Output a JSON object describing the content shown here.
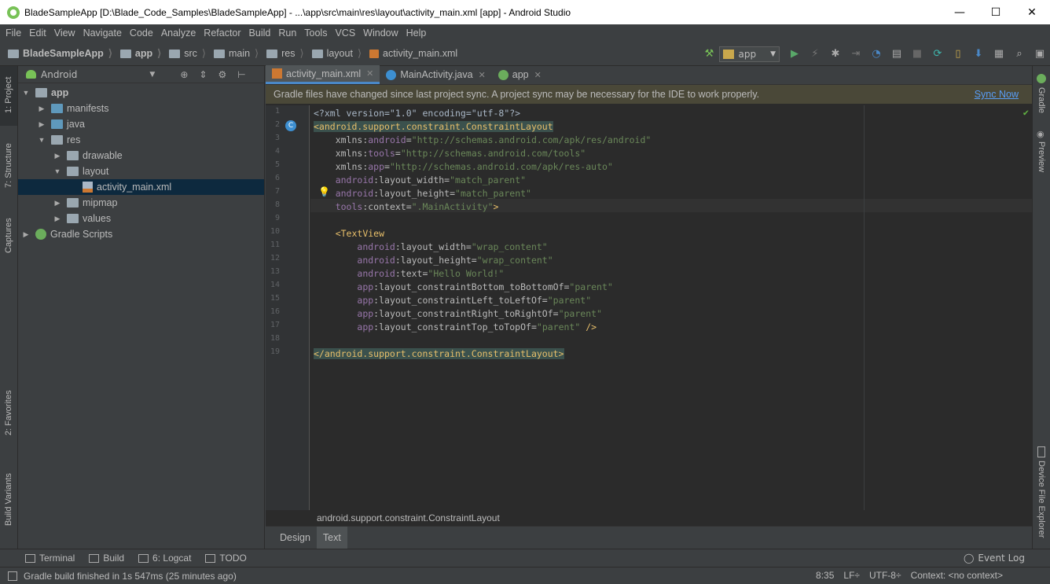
{
  "window": {
    "title": "BladeSampleApp [D:\\Blade_Code_Samples\\BladeSampleApp] - ...\\app\\src\\main\\res\\layout\\activity_main.xml [app] - Android Studio",
    "minimize": "—",
    "maximize": "☐",
    "close": "✕"
  },
  "menu": [
    "File",
    "Edit",
    "View",
    "Navigate",
    "Code",
    "Analyze",
    "Refactor",
    "Build",
    "Run",
    "Tools",
    "VCS",
    "Window",
    "Help"
  ],
  "breadcrumb": [
    "BladeSampleApp",
    "app",
    "src",
    "main",
    "res",
    "layout",
    "activity_main.xml"
  ],
  "toolbar": {
    "run_config": "app"
  },
  "left_strip": [
    "1: Project",
    "7: Structure",
    "Captures",
    "2: Favorites",
    "Build Variants"
  ],
  "right_strip": [
    "Gradle",
    "Preview",
    "Device File Explorer"
  ],
  "project_panel": {
    "view_mode": "Android",
    "tree": [
      {
        "label": "app",
        "depth": 0,
        "expanded": true,
        "icon": "module-folder-icon"
      },
      {
        "label": "manifests",
        "depth": 1,
        "expanded": false,
        "icon": "folder-icon"
      },
      {
        "label": "java",
        "depth": 1,
        "expanded": false,
        "icon": "folder-icon"
      },
      {
        "label": "res",
        "depth": 1,
        "expanded": true,
        "icon": "folder-icon"
      },
      {
        "label": "drawable",
        "depth": 2,
        "expanded": false,
        "icon": "folder-icon"
      },
      {
        "label": "layout",
        "depth": 2,
        "expanded": true,
        "icon": "folder-icon"
      },
      {
        "label": "activity_main.xml",
        "depth": 3,
        "expanded": null,
        "icon": "xml-file-icon",
        "selected": true
      },
      {
        "label": "mipmap",
        "depth": 2,
        "expanded": false,
        "icon": "folder-icon"
      },
      {
        "label": "values",
        "depth": 2,
        "expanded": false,
        "icon": "folder-icon"
      },
      {
        "label": "Gradle Scripts",
        "depth": 0,
        "expanded": false,
        "icon": "gradle-icon"
      }
    ]
  },
  "editor": {
    "tabs": [
      {
        "label": "activity_main.xml",
        "active": true
      },
      {
        "label": "MainActivity.java",
        "active": false
      },
      {
        "label": "app",
        "active": false
      }
    ],
    "banner_message": "Gradle files have changed since last project sync. A project sync may be necessary for the IDE to work properly.",
    "banner_action": "Sync Now",
    "line_numbers": [
      "1",
      "2",
      "3",
      "4",
      "5",
      "6",
      "7",
      "8",
      "9",
      "10",
      "11",
      "12",
      "13",
      "14",
      "15",
      "16",
      "17",
      "18",
      "19"
    ],
    "code_lines": [
      [
        [
          "t-plain",
          "<?xml version=\"1.0\" encoding=\"utf-8\"?>"
        ]
      ],
      [
        [
          "t-tag tagbg",
          "<android.support.constraint.ConstraintLayout"
        ]
      ],
      [
        [
          "t-plain",
          "    "
        ],
        [
          "t-attr",
          "xmlns:"
        ],
        [
          "t-ns",
          "android"
        ],
        [
          "t-attr",
          "="
        ],
        [
          "t-val",
          "\"http://schemas.android.com/apk/res/android\""
        ]
      ],
      [
        [
          "t-plain",
          "    "
        ],
        [
          "t-attr",
          "xmlns:"
        ],
        [
          "t-ns",
          "tools"
        ],
        [
          "t-attr",
          "="
        ],
        [
          "t-val",
          "\"http://schemas.android.com/tools\""
        ]
      ],
      [
        [
          "t-plain",
          "    "
        ],
        [
          "t-attr",
          "xmlns:"
        ],
        [
          "t-ns",
          "app"
        ],
        [
          "t-attr",
          "="
        ],
        [
          "t-val",
          "\"http://schemas.android.com/apk/res-auto\""
        ]
      ],
      [
        [
          "t-plain",
          "    "
        ],
        [
          "t-ns",
          "android"
        ],
        [
          "t-attr",
          ":layout_width="
        ],
        [
          "t-val",
          "\"match_parent\""
        ]
      ],
      [
        [
          "t-plain",
          "    "
        ],
        [
          "t-ns",
          "android"
        ],
        [
          "t-attr",
          ":layout_height="
        ],
        [
          "t-val",
          "\"match_parent\""
        ]
      ],
      [
        [
          "t-plain",
          "    "
        ],
        [
          "t-ns",
          "tools"
        ],
        [
          "t-attr",
          ":context="
        ],
        [
          "t-val",
          "\".MainActivity\""
        ],
        [
          "t-tag",
          ">"
        ]
      ],
      [],
      [
        [
          "t-plain",
          "    "
        ],
        [
          "t-tag",
          "<TextView"
        ]
      ],
      [
        [
          "t-plain",
          "        "
        ],
        [
          "t-ns",
          "android"
        ],
        [
          "t-attr",
          ":layout_width="
        ],
        [
          "t-val",
          "\"wrap_content\""
        ]
      ],
      [
        [
          "t-plain",
          "        "
        ],
        [
          "t-ns",
          "android"
        ],
        [
          "t-attr",
          ":layout_height="
        ],
        [
          "t-val",
          "\"wrap_content\""
        ]
      ],
      [
        [
          "t-plain",
          "        "
        ],
        [
          "t-ns",
          "android"
        ],
        [
          "t-attr",
          ":text="
        ],
        [
          "t-val",
          "\"Hello World!\""
        ]
      ],
      [
        [
          "t-plain",
          "        "
        ],
        [
          "t-ns",
          "app"
        ],
        [
          "t-attr",
          ":layout_constraintBottom_toBottomOf="
        ],
        [
          "t-val",
          "\"parent\""
        ]
      ],
      [
        [
          "t-plain",
          "        "
        ],
        [
          "t-ns",
          "app"
        ],
        [
          "t-attr",
          ":layout_constraintLeft_toLeftOf="
        ],
        [
          "t-val",
          "\"parent\""
        ]
      ],
      [
        [
          "t-plain",
          "        "
        ],
        [
          "t-ns",
          "app"
        ],
        [
          "t-attr",
          ":layout_constraintRight_toRightOf="
        ],
        [
          "t-val",
          "\"parent\""
        ]
      ],
      [
        [
          "t-plain",
          "        "
        ],
        [
          "t-ns",
          "app"
        ],
        [
          "t-attr",
          ":layout_constraintTop_toTopOf="
        ],
        [
          "t-val",
          "\"parent\""
        ],
        [
          "t-tag",
          " />"
        ]
      ],
      [],
      [
        [
          "t-tag tagbg",
          "</android.support.constraint.ConstraintLayout>"
        ]
      ]
    ],
    "structure_breadcrumb": "android.support.constraint.ConstraintLayout",
    "mode_tabs": [
      "Design",
      "Text"
    ],
    "active_mode": "Text"
  },
  "bottom_tools": [
    {
      "label": "Terminal",
      "icon": "terminal-icon"
    },
    {
      "label": "Build",
      "icon": "build-icon"
    },
    {
      "label": "6: Logcat",
      "icon": "logcat-icon"
    },
    {
      "label": "TODO",
      "icon": "todo-icon"
    }
  ],
  "event_log": "Event Log",
  "status": {
    "message": "Gradle build finished in 1s 547ms (25 minutes ago)",
    "position": "8:35",
    "line_sep": "LF÷",
    "encoding": "UTF-8÷",
    "context": "Context: <no context>"
  },
  "colors": {
    "accent": "#4a88c7",
    "banner_bg": "#4a4838",
    "link": "#589df6",
    "selection": "#0d293e"
  }
}
